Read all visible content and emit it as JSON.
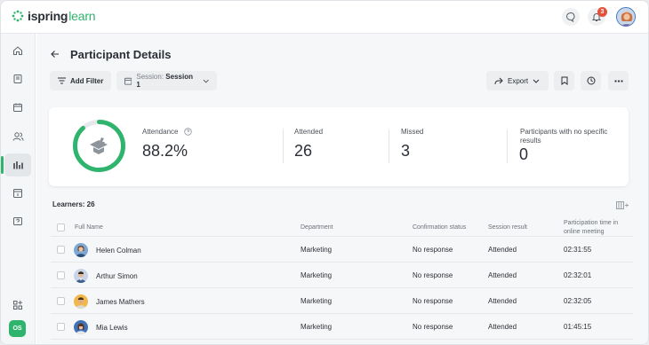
{
  "app": {
    "logo_part1": "ispring",
    "logo_part2": "learn",
    "notification_count": "3",
    "brand_color": "#2fb46e"
  },
  "sidebar": {
    "items": [
      {
        "icon": "home-icon"
      },
      {
        "icon": "book-icon"
      },
      {
        "icon": "calendar-icon"
      },
      {
        "icon": "users-icon"
      },
      {
        "icon": "reports-icon",
        "active": true
      },
      {
        "icon": "calendar-day-icon"
      },
      {
        "icon": "help-icon"
      }
    ],
    "bottom_add_icon": "apps-add-icon",
    "user_initials": "OS"
  },
  "page": {
    "title": "Participant Details",
    "add_filter_label": "Add Filter",
    "session_label": "Session:",
    "session_value": "Session 1",
    "export_label": "Export"
  },
  "stats": {
    "attendance_label": "Attendance",
    "attendance_value": "88.2%",
    "attendance_fraction": 0.882,
    "attended_label": "Attended",
    "attended_value": "26",
    "missed_label": "Missed",
    "missed_value": "3",
    "no_results_label_line1": "Participants with no specific",
    "no_results_label_line2": "results",
    "no_results_value": "0"
  },
  "table": {
    "learners_label": "Learners: 26",
    "headers": {
      "full_name": "Full Name",
      "department": "Department",
      "confirmation": "Confirmation status",
      "result": "Session result",
      "time_line1": "Participation time in",
      "time_line2": "online meeting"
    },
    "rows": [
      {
        "name": "Helen Colman",
        "department": "Marketing",
        "confirmation": "No response",
        "result": "Attended",
        "time": "02:31:55"
      },
      {
        "name": "Arthur Simon",
        "department": "Marketing",
        "confirmation": "No response",
        "result": "Attended",
        "time": "02:32:01"
      },
      {
        "name": "James Mathers",
        "department": "Marketing",
        "confirmation": "No response",
        "result": "Attended",
        "time": "02:32:05"
      },
      {
        "name": "Mia Lewis",
        "department": "Marketing",
        "confirmation": "No response",
        "result": "Attended",
        "time": "01:45:15"
      }
    ]
  }
}
